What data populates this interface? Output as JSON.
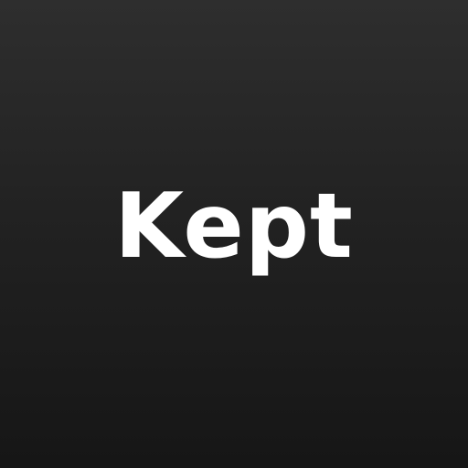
{
  "app": {
    "wordmark": "Kept"
  }
}
